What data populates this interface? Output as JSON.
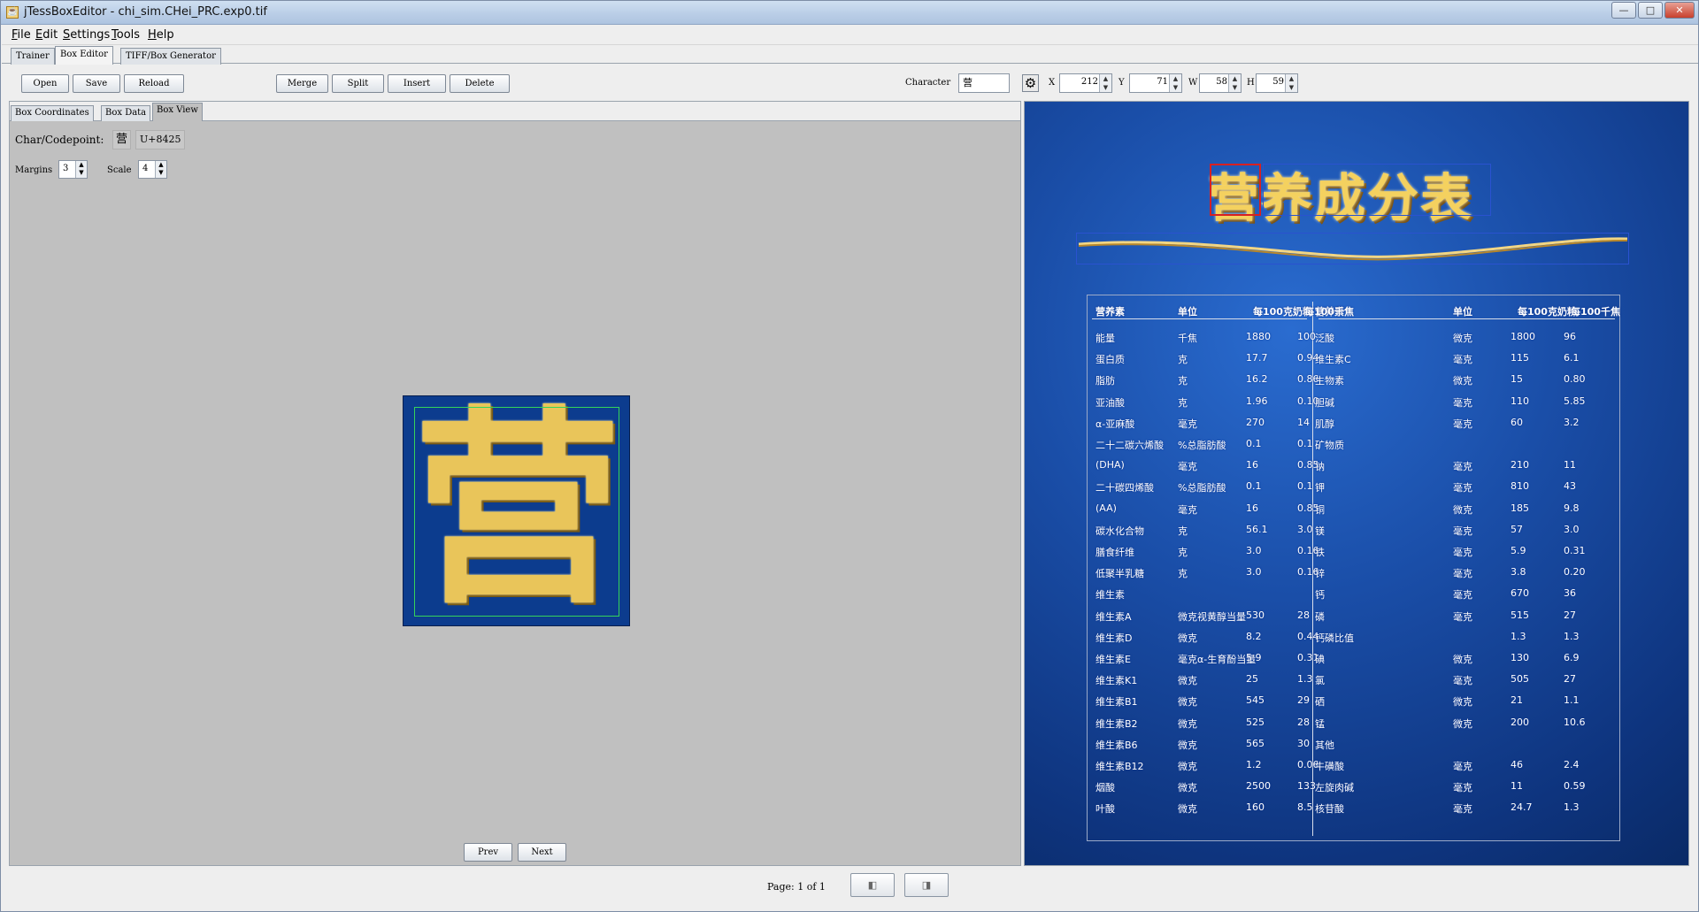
{
  "window": {
    "title": "jTessBoxEditor - chi_sim.CHei_PRC.exp0.tif",
    "app_icon": "java-cup-icon"
  },
  "menubar": [
    "File",
    "Edit",
    "Settings",
    "Tools",
    "Help"
  ],
  "main_tabs": {
    "trainer": "Trainer",
    "box_editor": "Box Editor",
    "tiff_box_generator": "TIFF/Box Generator",
    "active": "Box Editor"
  },
  "toolbar": {
    "open": "Open",
    "save": "Save",
    "reload": "Reload",
    "merge": "Merge",
    "split": "Split",
    "insert": "Insert",
    "delete": "Delete",
    "character_label": "Character",
    "character_value": "营",
    "x_label": "X",
    "x_value": "212",
    "y_label": "Y",
    "y_value": "71",
    "w_label": "W",
    "w_value": "58",
    "h_label": "H",
    "h_value": "59",
    "settings_icon": "gear-icon"
  },
  "sub_tabs": {
    "box_coordinates": "Box Coordinates",
    "box_data": "Box Data",
    "box_view": "Box View",
    "active": "Box View"
  },
  "box_view": {
    "char_label": "Char/Codepoint:",
    "char": "营",
    "codepoint": "U+8425",
    "margins_label": "Margins",
    "margins_value": "3",
    "scale_label": "Scale",
    "scale_value": "4",
    "glyph_char": "营",
    "prev": "Prev",
    "next": "Next"
  },
  "image": {
    "title_first": "营",
    "title_rest": "养成分表",
    "table_header_left": [
      "营养素",
      "单位",
      "每100克奶粉",
      "每100千焦"
    ],
    "table_header_right": [
      "营养素",
      "单位",
      "每100克奶粉",
      "每100千焦"
    ],
    "left_rows": [
      [
        "能量",
        "千焦",
        "1880",
        "100"
      ],
      [
        "蛋白质",
        "克",
        "17.7",
        "0.94"
      ],
      [
        "脂肪",
        "克",
        "16.2",
        "0.86"
      ],
      [
        "亚油酸",
        "克",
        "1.96",
        "0.10"
      ],
      [
        "α-亚麻酸",
        "毫克",
        "270",
        "14"
      ],
      [
        "二十二碳六烯酸",
        "%总脂肪酸",
        "0.1",
        "0.1"
      ],
      [
        "(DHA)",
        "毫克",
        "16",
        "0.85"
      ],
      [
        "二十碳四烯酸",
        "%总脂肪酸",
        "0.1",
        "0.1"
      ],
      [
        "(AA)",
        "毫克",
        "16",
        "0.85"
      ],
      [
        "碳水化合物",
        "克",
        "56.1",
        "3.0"
      ],
      [
        "膳食纤维",
        "克",
        "3.0",
        "0.16"
      ],
      [
        "低聚半乳糖",
        "克",
        "3.0",
        "0.16"
      ],
      [
        "维生素",
        "",
        "",
        ""
      ],
      [
        "维生素A",
        "微克视黄醇当量",
        "530",
        "28"
      ],
      [
        "维生素D",
        "微克",
        "8.2",
        "0.44"
      ],
      [
        "维生素E",
        "毫克α-生育酚当量",
        "5.9",
        "0.31"
      ],
      [
        "维生素K1",
        "微克",
        "25",
        "1.3"
      ],
      [
        "维生素B1",
        "微克",
        "545",
        "29"
      ],
      [
        "维生素B2",
        "微克",
        "525",
        "28"
      ],
      [
        "维生素B6",
        "微克",
        "565",
        "30"
      ],
      [
        "维生素B12",
        "微克",
        "1.2",
        "0.06"
      ],
      [
        "烟酸",
        "微克",
        "2500",
        "133"
      ],
      [
        "叶酸",
        "微克",
        "160",
        "8.5"
      ]
    ],
    "right_rows": [
      [
        "泛酸",
        "微克",
        "1800",
        "96"
      ],
      [
        "维生素C",
        "毫克",
        "115",
        "6.1"
      ],
      [
        "生物素",
        "微克",
        "15",
        "0.80"
      ],
      [
        "胆碱",
        "毫克",
        "110",
        "5.85"
      ],
      [
        "肌醇",
        "毫克",
        "60",
        "3.2"
      ],
      [
        "矿物质",
        "",
        "",
        ""
      ],
      [
        "钠",
        "毫克",
        "210",
        "11"
      ],
      [
        "钾",
        "毫克",
        "810",
        "43"
      ],
      [
        "铜",
        "微克",
        "185",
        "9.8"
      ],
      [
        "镁",
        "毫克",
        "57",
        "3.0"
      ],
      [
        "铁",
        "毫克",
        "5.9",
        "0.31"
      ],
      [
        "锌",
        "毫克",
        "3.8",
        "0.20"
      ],
      [
        "钙",
        "毫克",
        "670",
        "36"
      ],
      [
        "磷",
        "毫克",
        "515",
        "27"
      ],
      [
        "钙磷比值",
        "",
        "1.3",
        "1.3"
      ],
      [
        "碘",
        "微克",
        "130",
        "6.9"
      ],
      [
        "氯",
        "毫克",
        "505",
        "27"
      ],
      [
        "硒",
        "微克",
        "21",
        "1.1"
      ],
      [
        "锰",
        "微克",
        "200",
        "10.6"
      ],
      [
        "其他",
        "",
        "",
        ""
      ],
      [
        "牛磺酸",
        "毫克",
        "46",
        "2.4"
      ],
      [
        "左旋肉碱",
        "毫克",
        "11",
        "0.59"
      ],
      [
        "核苷酸",
        "毫克",
        "24.7",
        "1.3"
      ]
    ]
  },
  "status": {
    "page_text": "Page: 1 of 1",
    "prev_page_icon": "prev-page-icon",
    "next_page_icon": "next-page-icon"
  }
}
